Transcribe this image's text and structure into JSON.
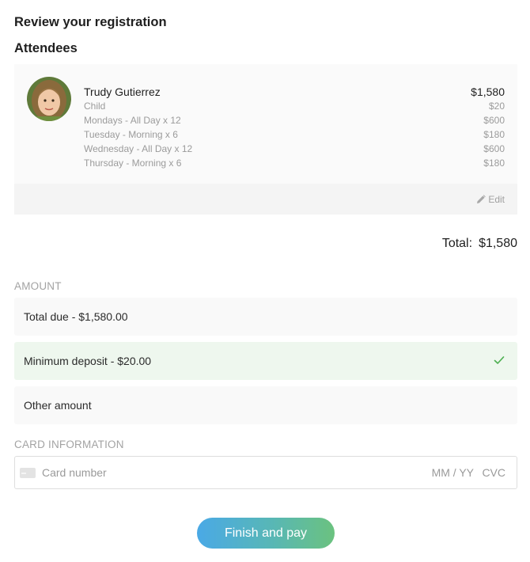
{
  "page": {
    "title": "Review your registration",
    "attendees_heading": "Attendees"
  },
  "attendee": {
    "name": "Trudy Gutierrez",
    "total": "$1,580",
    "lines": [
      {
        "label": "Child",
        "amount": "$20"
      },
      {
        "label": "Mondays - All Day x 12",
        "amount": "$600"
      },
      {
        "label": "Tuesday - Morning x 6",
        "amount": "$180"
      },
      {
        "label": "Wednesday - All Day x 12",
        "amount": "$600"
      },
      {
        "label": "Thursday - Morning x 6",
        "amount": "$180"
      }
    ],
    "edit_label": "Edit"
  },
  "summary": {
    "total_label": "Total:",
    "total_value": "$1,580"
  },
  "amount": {
    "heading": "AMOUNT",
    "options": [
      {
        "label": "Total due - $1,580.00",
        "selected": false
      },
      {
        "label": "Minimum deposit - $20.00",
        "selected": true
      },
      {
        "label": "Other amount",
        "selected": false
      }
    ]
  },
  "card": {
    "heading": "CARD INFORMATION",
    "number_placeholder": "Card number",
    "expiry_placeholder": "MM / YY",
    "cvc_placeholder": "CVC"
  },
  "actions": {
    "pay_label": "Finish and pay"
  },
  "colors": {
    "selected_bg": "#eef7ee",
    "check": "#4caf50",
    "button_gradient_start": "#4aa9e6",
    "button_gradient_end": "#6bc27f"
  },
  "icons": {
    "edit": "pencil-icon",
    "check": "check-icon",
    "card": "credit-card-icon"
  }
}
